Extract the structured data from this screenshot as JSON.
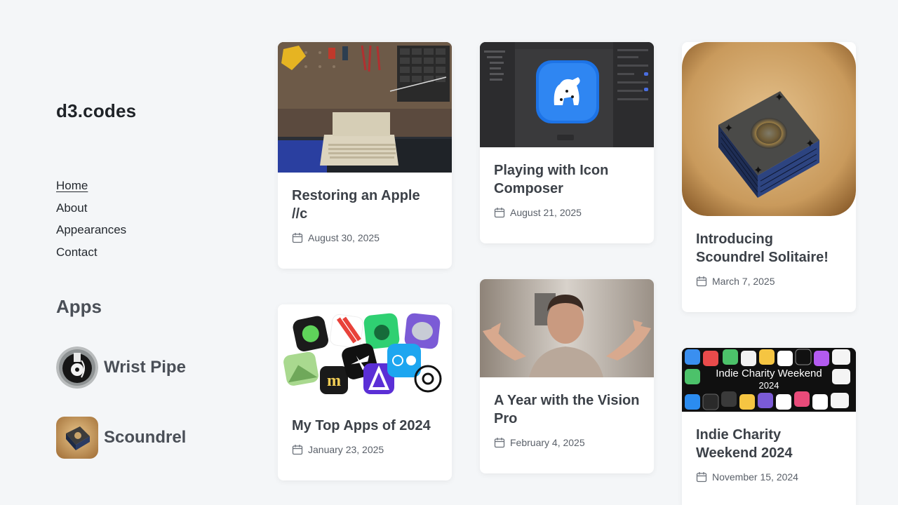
{
  "site": {
    "title": "d3.codes"
  },
  "nav": {
    "items": [
      {
        "label": "Home"
      },
      {
        "label": "About"
      },
      {
        "label": "Appearances"
      },
      {
        "label": "Contact"
      }
    ]
  },
  "apps": {
    "heading": "Apps",
    "items": [
      {
        "name": "Wrist Pipe",
        "icon": "wrist-pipe-icon"
      },
      {
        "name": "Scoundrel",
        "icon": "scoundrel-icon"
      }
    ]
  },
  "posts": [
    {
      "title": "Restoring an Apple //c",
      "date": "August 30, 2025",
      "image": "apple-iic-workbench-photo"
    },
    {
      "title": "My Top Apps of 2024",
      "date": "January 23, 2025",
      "image": "app-icons-collage"
    },
    {
      "title": "Playing with Icon Composer",
      "date": "August 21, 2025",
      "image": "icon-composer-screenshot"
    },
    {
      "title": "A Year with the Vision Pro",
      "date": "February 4, 2025",
      "image": "vision-pro-video-still"
    },
    {
      "title": "Introducing Scoundrel Solitaire!",
      "date": "March 7, 2025",
      "image": "scoundrel-card-deck-art"
    },
    {
      "title": "Indie Charity Weekend 2024",
      "date": "November 15, 2024",
      "image": "indie-charity-weekend-banner"
    }
  ],
  "banner_text": {
    "line1": "Indie Charity Weekend",
    "line2": "2024"
  },
  "colors": {
    "background": "#f4f6f8",
    "card": "#ffffff",
    "title": "#3c4148",
    "muted": "#5a6069"
  }
}
